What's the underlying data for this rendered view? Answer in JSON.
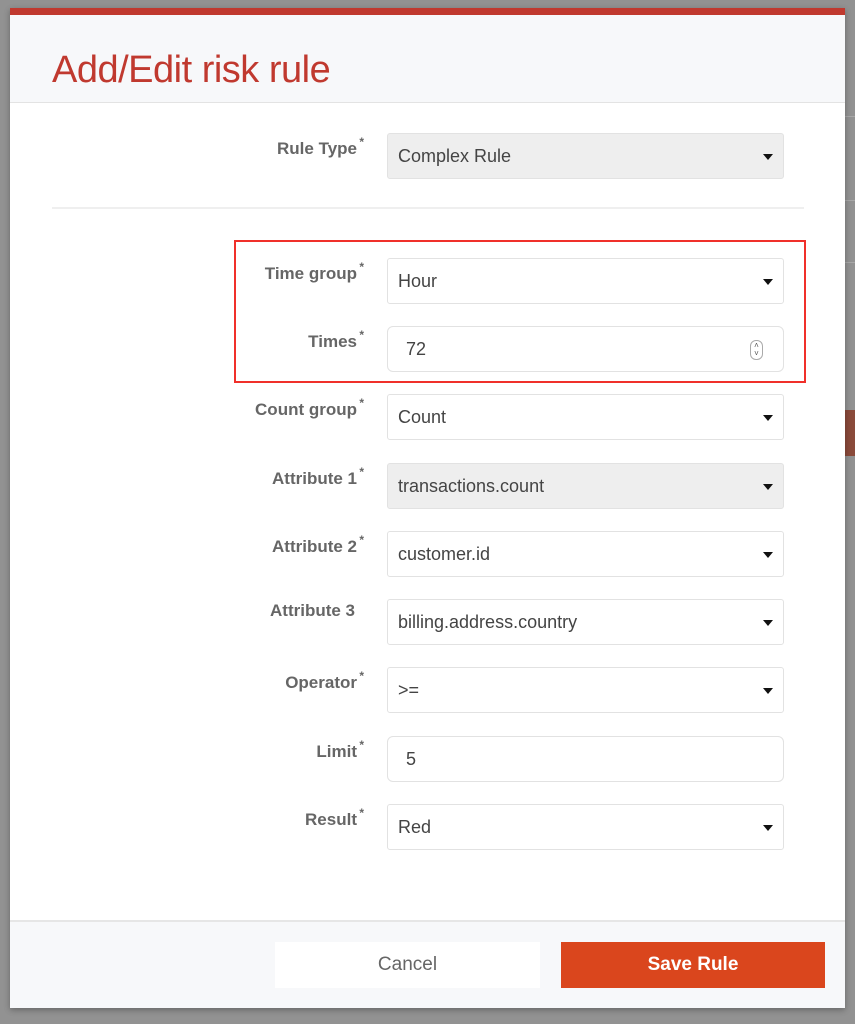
{
  "dialog": {
    "title": "Add/Edit risk rule"
  },
  "form": {
    "rule_type": {
      "label": "Rule Type",
      "value": "Complex Rule"
    },
    "time_group": {
      "label": "Time group",
      "value": "Hour"
    },
    "times": {
      "label": "Times",
      "value": "72"
    },
    "count_group": {
      "label": "Count group",
      "value": "Count"
    },
    "attribute1": {
      "label": "Attribute 1",
      "value": "transactions.count"
    },
    "attribute2": {
      "label": "Attribute 2",
      "value": "customer.id"
    },
    "attribute3": {
      "label": "Attribute 3",
      "value": "billing.address.country"
    },
    "operator": {
      "label": "Operator",
      "value": ">="
    },
    "limit": {
      "label": "Limit",
      "value": "5"
    },
    "result": {
      "label": "Result",
      "value": "Red"
    }
  },
  "footer": {
    "cancel_label": "Cancel",
    "save_label": "Save Rule"
  },
  "colors": {
    "accent": "#c0392f",
    "save_button": "#da461d",
    "highlight_box": "#f0302a"
  }
}
